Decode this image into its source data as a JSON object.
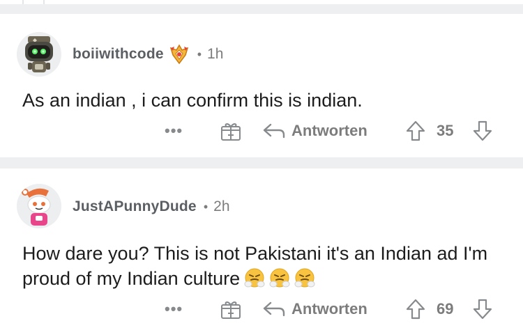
{
  "comments": [
    {
      "username": "boiiwithcode",
      "separator": "•",
      "time": "1h",
      "body": "As an indian , i can confirm this is indian.",
      "more_label": "•••",
      "reply_label": "Antworten",
      "score": "35",
      "has_badge": true
    },
    {
      "username": "JustAPunnyDude",
      "separator": "•",
      "time": "2h",
      "body": "How dare you? This is not Pakistani it's an Indian ad I'm proud of my Indian culture",
      "emojis": [
        "steam-from-nose-emoji",
        "steam-from-nose-emoji",
        "steam-from-nose-emoji"
      ],
      "more_label": "•••",
      "reply_label": "Antworten",
      "score": "69",
      "has_badge": false
    }
  ],
  "colors": {
    "divider": "#edeff1",
    "meta_text": "#7c7c7c",
    "username": "#5b5f63",
    "body": "#1c1c1c",
    "icon": "#878a8c"
  }
}
